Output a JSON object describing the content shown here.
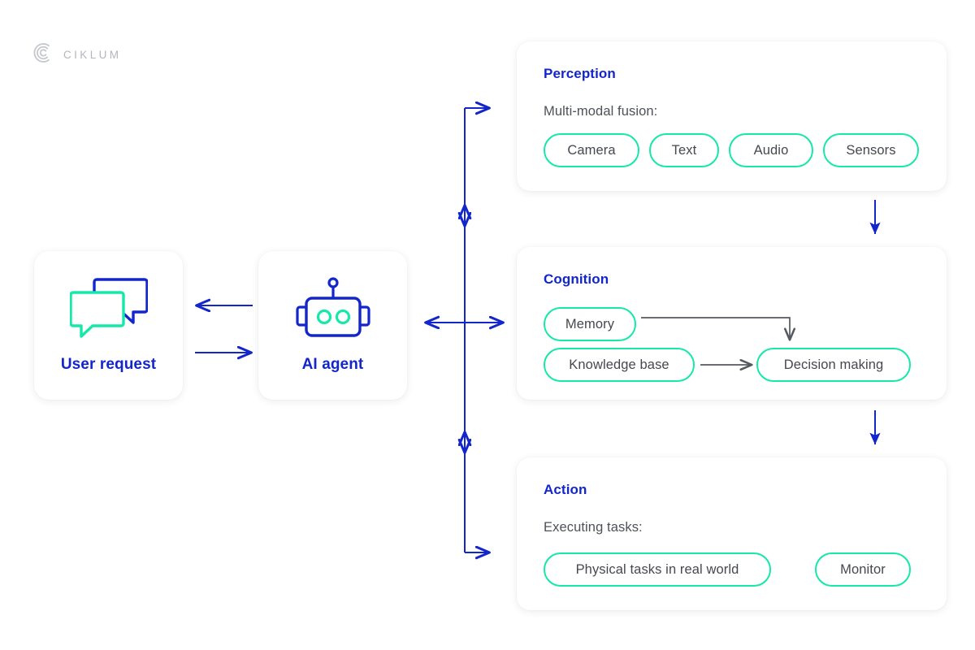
{
  "brand": {
    "name": "CIKLUM",
    "logo_icon": "ciklum-arcs-logo-icon",
    "logo_color": "#b3b6bd"
  },
  "colors": {
    "accent_blue": "#1226cc",
    "accent_green": "#15e8a8",
    "arrow_blue": "#1226cc",
    "arrow_gray": "#555a61",
    "text_gray": "#45484f",
    "background": "#ffffff",
    "card_background": "#ffffff"
  },
  "nodes": [
    {
      "id": "user-request",
      "label": "User request",
      "icon": "chat-bubbles-icon"
    },
    {
      "id": "ai-agent",
      "label": "AI agent",
      "icon": "robot-head-icon"
    }
  ],
  "stages": [
    {
      "id": "perception",
      "title": "Perception",
      "subtitle": "Multi-modal fusion:",
      "pills": [
        "Camera",
        "Text",
        "Audio",
        "Sensors"
      ]
    },
    {
      "id": "cognition",
      "title": "Cognition",
      "subtitle": "",
      "pills": [
        "Memory",
        "Knowledge base",
        "Decision making"
      ]
    },
    {
      "id": "action",
      "title": "Action",
      "subtitle": "Executing tasks:",
      "pills": [
        "Physical tasks in real world",
        "Monitor"
      ]
    }
  ],
  "connectors": [
    {
      "id": "ai-agent-to-user-request",
      "direction": "left",
      "style": "solid",
      "color": "#1226cc"
    },
    {
      "id": "user-request-to-ai-agent",
      "direction": "right",
      "style": "solid",
      "color": "#1226cc"
    },
    {
      "id": "bus-to-perception",
      "direction": "right",
      "style": "solid",
      "color": "#1226cc"
    },
    {
      "id": "bus-perception-cognition-bidirectional",
      "direction": "both-vertical",
      "style": "solid",
      "color": "#1226cc"
    },
    {
      "id": "ai-agent-to-bus-bidirectional",
      "direction": "both-horizontal",
      "style": "solid",
      "color": "#1226cc"
    },
    {
      "id": "bus-cognition-action-bidirectional",
      "direction": "both-vertical",
      "style": "solid",
      "color": "#1226cc"
    },
    {
      "id": "bus-to-action",
      "direction": "right",
      "style": "solid",
      "color": "#1226cc"
    },
    {
      "id": "perception-to-cognition",
      "direction": "down",
      "style": "solid",
      "color": "#1226cc"
    },
    {
      "id": "cognition-to-action",
      "direction": "down",
      "style": "solid",
      "color": "#1226cc"
    },
    {
      "id": "memory-to-decision-making",
      "direction": "right-then-down",
      "style": "solid",
      "color": "#555a61"
    },
    {
      "id": "knowledge-base-to-decision-making",
      "direction": "right",
      "style": "solid",
      "color": "#555a61"
    }
  ]
}
